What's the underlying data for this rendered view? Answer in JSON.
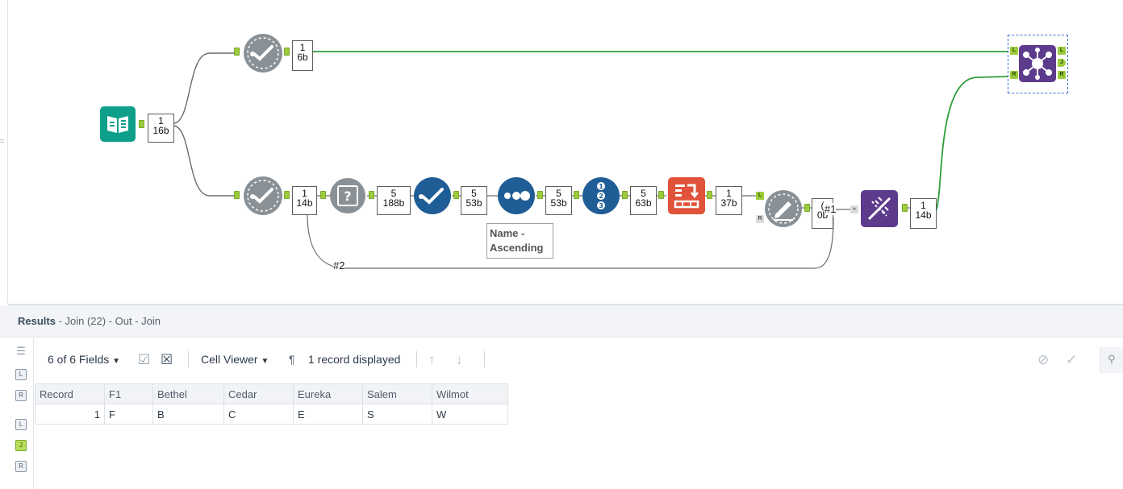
{
  "workflow": {
    "connection_labels": {
      "wire_1": "#1",
      "wire_2": "#2"
    },
    "tools": [
      {
        "id": "input",
        "icon": "text-input-book-icon"
      },
      {
        "id": "select_top",
        "icon": "select-check-gear-icon"
      },
      {
        "id": "select_bottom",
        "icon": "select-check-gear-icon"
      },
      {
        "id": "browse_question",
        "icon": "question-box-icon"
      },
      {
        "id": "filter_check",
        "icon": "check-circle-icon"
      },
      {
        "id": "sort",
        "icon": "dots-circle-icon"
      },
      {
        "id": "record_id",
        "icon": "numbered-list-icon"
      },
      {
        "id": "transpose",
        "icon": "transpose-icon"
      },
      {
        "id": "append",
        "icon": "pencil-gear-icon"
      },
      {
        "id": "dynamic",
        "icon": "dna-icon"
      },
      {
        "id": "join",
        "icon": "join-network-icon"
      }
    ],
    "counts": {
      "input": {
        "records": "1",
        "size": "16b"
      },
      "select_top": {
        "records": "1",
        "size": "6b"
      },
      "select_bottom": {
        "records": "1",
        "size": "14b"
      },
      "browse_question": {
        "records": "5",
        "size": "188b"
      },
      "filter_check": {
        "records": "5",
        "size": "53b"
      },
      "sort": {
        "records": "5",
        "size": "53b"
      },
      "record_id": {
        "records": "5",
        "size": "63b"
      },
      "transpose": {
        "records": "1",
        "size": "37b"
      },
      "append": {
        "records": "(",
        "size": "0b"
      },
      "dynamic": {
        "records": "1",
        "size": "14b"
      }
    },
    "annotation": "Name - Ascending",
    "anchors": {
      "left": "L",
      "right": "R",
      "join": "J"
    }
  },
  "results": {
    "title_bold": "Results",
    "title_rest": " - Join (22) - Out - Join",
    "toolbar": {
      "fields_selector": "6 of 6 Fields",
      "cell_viewer": "Cell Viewer",
      "pilcrow": "¶",
      "records_displayed": "1 record displayed"
    },
    "columns": [
      "Record",
      "F1",
      "Bethel",
      "Cedar",
      "Eureka",
      "Salem",
      "Wilmot"
    ],
    "rows": [
      [
        "1",
        "F",
        "B",
        "C",
        "E",
        "S",
        "W"
      ]
    ],
    "side_icons": [
      "list-icon",
      "L",
      "R",
      "L",
      "J",
      "R"
    ]
  },
  "colors": {
    "wire_default": "#6b6b6b",
    "wire_join": "#2e9e3a",
    "anchor": "#9ccc3c",
    "teal_input": "#0e9f8b",
    "grey_tool": "#8a9196",
    "blue_tool": "#1f5d96",
    "orange_tool": "#e0533a",
    "purple_tool": "#5c3a8c"
  }
}
